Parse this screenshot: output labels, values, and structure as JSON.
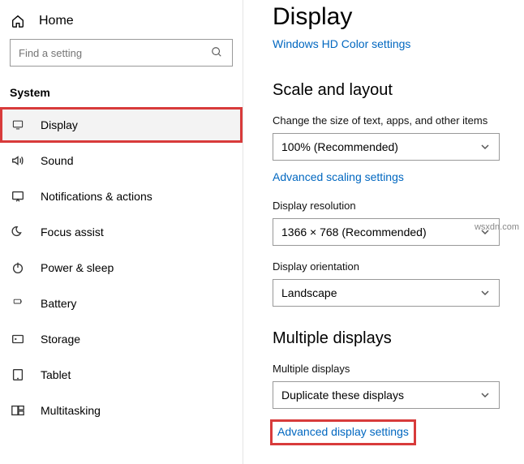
{
  "sidebar": {
    "home": "Home",
    "search_placeholder": "Find a setting",
    "section": "System",
    "items": [
      {
        "label": "Display"
      },
      {
        "label": "Sound"
      },
      {
        "label": "Notifications & actions"
      },
      {
        "label": "Focus assist"
      },
      {
        "label": "Power & sleep"
      },
      {
        "label": "Battery"
      },
      {
        "label": "Storage"
      },
      {
        "label": "Tablet"
      },
      {
        "label": "Multitasking"
      }
    ]
  },
  "main": {
    "title": "Display",
    "hd_link": "Windows HD Color settings",
    "scale_heading": "Scale and layout",
    "text_size_label": "Change the size of text, apps, and other items",
    "text_size_value": "100% (Recommended)",
    "adv_scale_link": "Advanced scaling settings",
    "resolution_label": "Display resolution",
    "resolution_value": "1366 × 768 (Recommended)",
    "orientation_label": "Display orientation",
    "orientation_value": "Landscape",
    "multi_heading": "Multiple displays",
    "multi_label": "Multiple displays",
    "multi_value": "Duplicate these displays",
    "adv_display_link": "Advanced display settings"
  },
  "watermark": "wsxdn.com"
}
